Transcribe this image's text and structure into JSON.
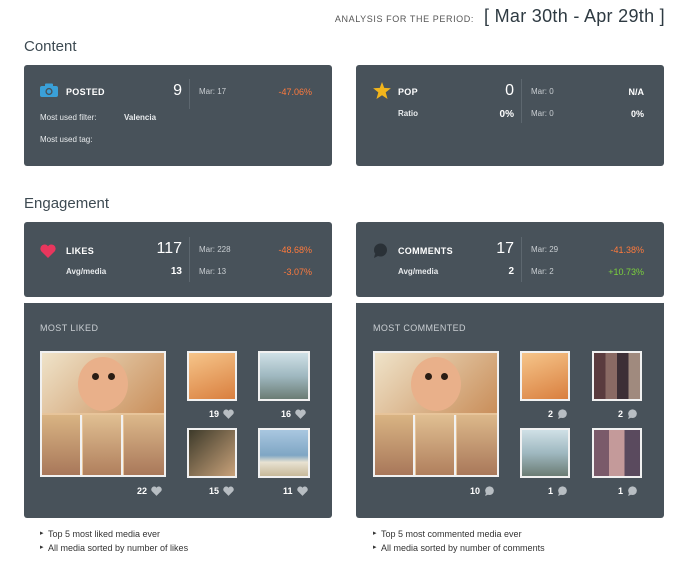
{
  "period": {
    "label": "ANALYSIS FOR THE PERIOD:",
    "range": "[ Mar 30th - Apr 29th ]"
  },
  "sections": {
    "content": "Content",
    "engagement": "Engagement"
  },
  "posted": {
    "label": "POSTED",
    "value": "9",
    "prev": "Mar: 17",
    "change": "-47.06%",
    "filter_label": "Most used filter:",
    "filter_value": "Valencia",
    "tag_label": "Most used tag:"
  },
  "pop": {
    "label": "POP",
    "value": "0",
    "prev": "Mar: 0",
    "change": "N/A",
    "ratio_label": "Ratio",
    "ratio_value": "0%",
    "ratio_prev": "Mar: 0",
    "ratio_change": "0%"
  },
  "likes": {
    "label": "LIKES",
    "value": "117",
    "prev": "Mar: 228",
    "change": "-48.68%",
    "avg_label": "Avg/media",
    "avg_value": "13",
    "avg_prev": "Mar: 13",
    "avg_change": "-3.07%"
  },
  "comments": {
    "label": "COMMENTS",
    "value": "17",
    "prev": "Mar: 29",
    "change": "-41.38%",
    "avg_label": "Avg/media",
    "avg_value": "2",
    "avg_prev": "Mar: 2",
    "avg_change": "+10.73%"
  },
  "most_liked": {
    "title": "MOST LIKED",
    "counts": [
      "22",
      "19",
      "16",
      "15",
      "11"
    ]
  },
  "most_commented": {
    "title": "MOST COMMENTED",
    "counts": [
      "10",
      "2",
      "2",
      "1",
      "1"
    ]
  },
  "notes_liked": [
    "Top 5 most liked media ever",
    "All media sorted by number of likes"
  ],
  "notes_commented": [
    "Top 5 most commented media ever",
    "All media sorted by number of comments"
  ],
  "colors": {
    "card": "#48525a",
    "negative": "#ff7a3c",
    "positive": "#7bd13c",
    "heart": "#e8365d",
    "star": "#f2b51c",
    "camera": "#3aa0d8"
  },
  "icons": {
    "posted": "camera-icon",
    "pop": "star-icon",
    "likes": "heart-icon",
    "comments": "comment-bubble-icon"
  }
}
